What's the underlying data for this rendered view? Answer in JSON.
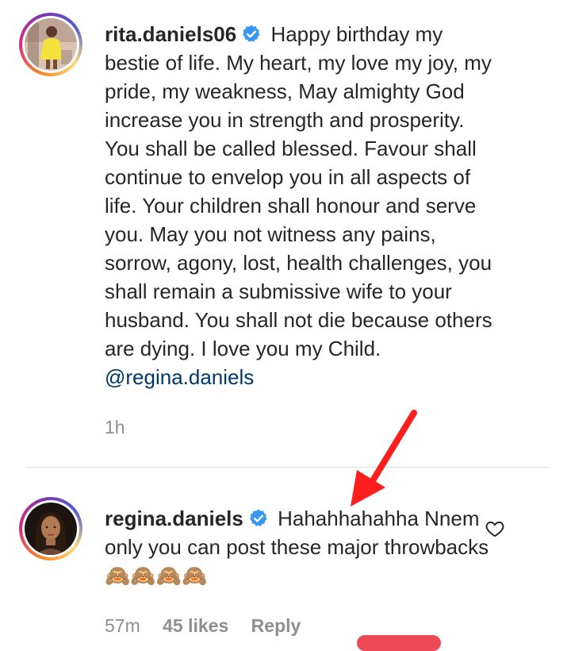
{
  "comments": [
    {
      "username": "rita.daniels06",
      "text": "Happy birthday my bestie of life. My heart, my love my joy, my pride, my weakness, May almighty God increase you in strength and prosperity. You shall be called blessed. Favour shall continue to envelop you in all aspects of life. Your children shall honour and serve you. May you not witness any pains, sorrow, agony, lost, health challenges, you shall remain a submissive wife to your husband. You shall not die because others are dying. I love you my Child.",
      "mention": "@regina.daniels",
      "time": "1h",
      "avatar_icon": "profile-photo-woman-yellow-dress"
    },
    {
      "username": "regina.daniels",
      "text": "Hahahhahahha Nnem only you can post these major throwbacks",
      "emoji": "🙈🙈🙈🙈",
      "time": "57m",
      "likes": "45 likes",
      "reply_label": "Reply",
      "avatar_icon": "profile-photo-woman-portrait"
    }
  ],
  "icons": {
    "verified": "verified-badge-icon",
    "like": "heart-outline-icon"
  },
  "colors": {
    "verified_blue": "#3897f0",
    "mention": "#00376b",
    "meta_gray": "#8e8e8e",
    "annotation_arrow": "#ff1e1e"
  }
}
